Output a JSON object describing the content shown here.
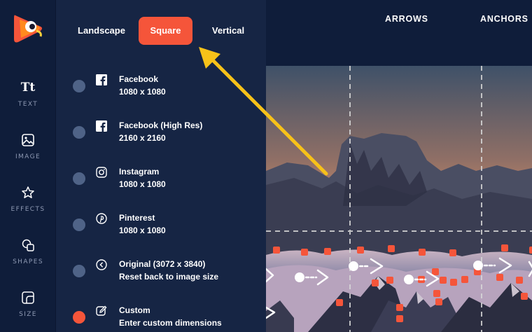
{
  "rail": {
    "items": [
      {
        "label": "TEXT",
        "icon": "text-icon",
        "glyph": "Tt"
      },
      {
        "label": "IMAGE",
        "icon": "image-icon"
      },
      {
        "label": "EFFECTS",
        "icon": "star-icon"
      },
      {
        "label": "SHAPES",
        "icon": "shapes-icon"
      },
      {
        "label": "SIZE",
        "icon": "size-icon"
      }
    ]
  },
  "tabs": [
    {
      "label": "Landscape",
      "active": false
    },
    {
      "label": "Square",
      "active": true
    },
    {
      "label": "Vertical",
      "active": false
    }
  ],
  "presets": [
    {
      "title": "Facebook",
      "size": "1080 x 1080",
      "icon": "facebook-icon",
      "selected": false
    },
    {
      "title": "Facebook (High Res)",
      "size": "2160 x 2160",
      "icon": "facebook-icon",
      "selected": false
    },
    {
      "title": "Instagram",
      "size": "1080 x 1080",
      "icon": "instagram-icon",
      "selected": false
    },
    {
      "title": "Pinterest",
      "size": "1080 x 1080",
      "icon": "pinterest-icon",
      "selected": false
    },
    {
      "title": "Original (3072 x 3840)",
      "size": "Reset back to image size",
      "icon": "reset-icon",
      "selected": false
    },
    {
      "title": "Custom",
      "size": "Enter custom dimensions",
      "icon": "edit-icon",
      "selected": true
    }
  ],
  "topnav": {
    "arrows": "ARROWS",
    "anchors": "ANCHORS"
  },
  "colors": {
    "accent": "#f5553a",
    "callout": "#f7c219",
    "panel": "#162544",
    "rail": "#0f1d3a"
  }
}
